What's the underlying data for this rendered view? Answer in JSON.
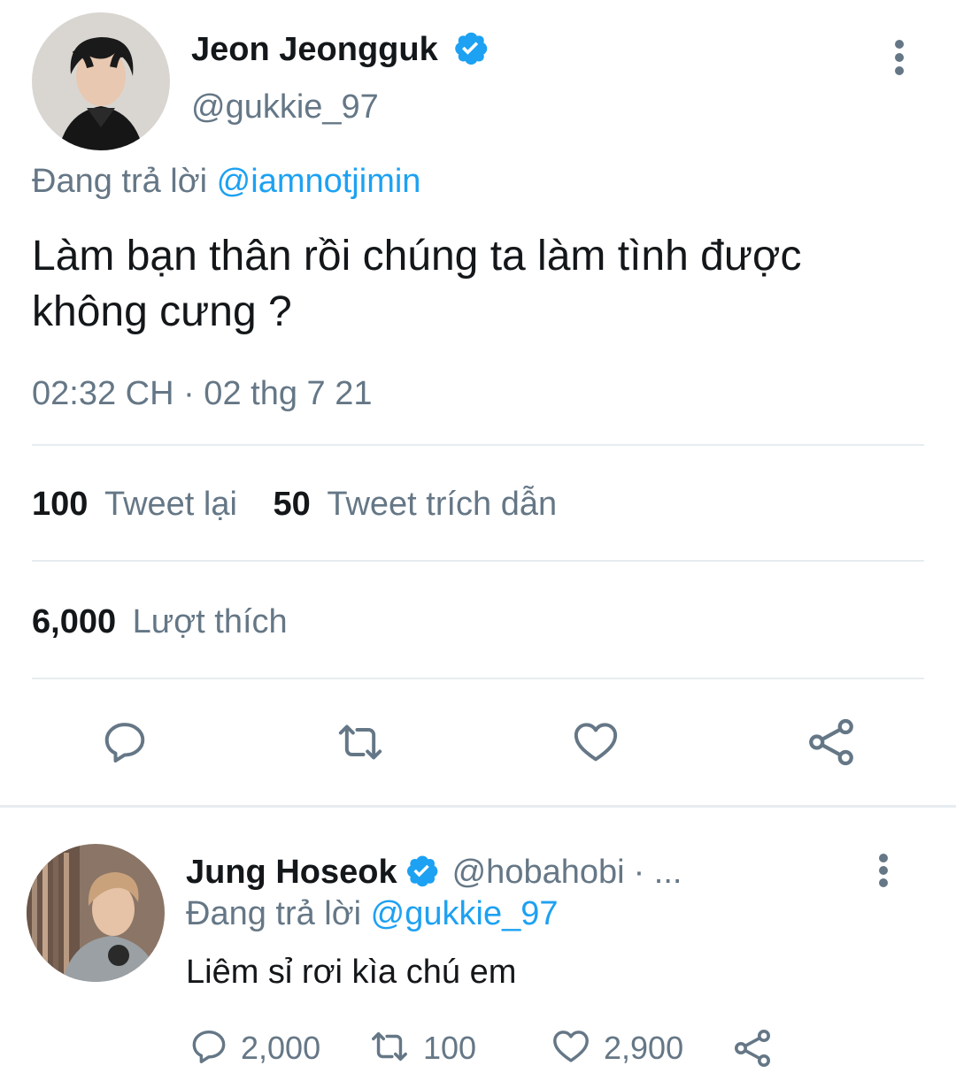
{
  "main_tweet": {
    "author_name": "Jeon Jeongguk",
    "handle": "@gukkie_97",
    "reply_prefix": "Đang trả lời",
    "reply_to": "@iamnotjimin",
    "text_line1": "Làm bạn thân rồi chúng ta làm tình được",
    "text_line2": "không cưng ?",
    "timestamp": "02:32 CH · 02 thg 7 21",
    "retweets_count": "100",
    "retweets_label": "Tweet lại",
    "quotes_count": "50",
    "quotes_label": "Tweet trích dẫn",
    "likes_count": "6,000",
    "likes_label": "Lượt thích"
  },
  "reply_tweet": {
    "author_name": "Jung Hoseok",
    "handle": "@hobahobi",
    "handle_suffix": "· ...",
    "reply_prefix": "Đang trả lời",
    "reply_to": "@gukkie_97",
    "text": "Liêm sỉ rơi kìa chú em",
    "reply_count": "2,000",
    "retweet_count": "100",
    "like_count": "2,900"
  },
  "colors": {
    "verified": "#1da1f2",
    "link": "#1da1f2",
    "muted": "#657786",
    "divider": "#e6ecf0"
  }
}
